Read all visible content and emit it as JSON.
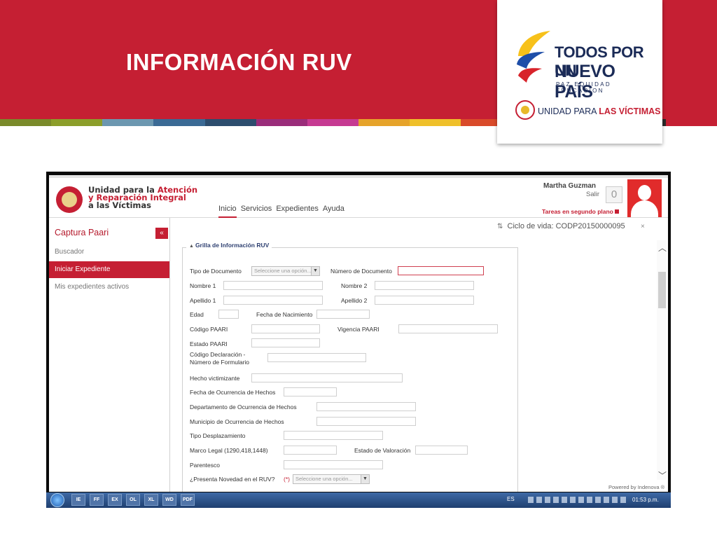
{
  "slide": {
    "title": "INFORMACIÓN RUV",
    "header_color": "#c51f33",
    "strip_colors": [
      "#7a8a2a",
      "#8c9e2a",
      "#6c97b0",
      "#3b6a95",
      "#2d4d6e",
      "#9a2c7a",
      "#c63a92",
      "#e6a32a",
      "#efc02a",
      "#d94a2a",
      "#b03a3a",
      "#5a2a2a",
      "#2a2a2a",
      "#c51f33"
    ]
  },
  "logo_card": {
    "slogan_line1": "TODOS POR UN",
    "slogan_line2": "NUEVO PAÍS",
    "slogan_line3": "PAZ EQUIDAD EDUCACION",
    "unit_prefix": "UNIDAD PARA ",
    "unit_highlight": "LAS VÍCTIMAS"
  },
  "app": {
    "org_line1": "Unidad para la ",
    "org_line1_highlight": "Atención",
    "org_line2": "y Reparación Integral",
    "org_line3": "a las Víctimas",
    "nav": [
      "Inicio",
      "Servicios",
      "Expedientes",
      "Ayuda"
    ],
    "user_name": "Martha Guzman",
    "user_exit": "Salir",
    "counter": "0",
    "tasks_label": "Tareas en segundo plano",
    "sidebar": {
      "title": "Captura Paari",
      "collapse": "«",
      "items": [
        "Buscador",
        "Iniciar Expediente",
        "Mis expedientes activos"
      ]
    },
    "lifecycle": "Ciclo de vida: CODP20150000095",
    "grid_title": "Grilla de Información RUV",
    "form": {
      "tipo_documento": "Tipo de Documento",
      "select_placeholder": "Seleccione una opción...",
      "numero_documento": "Número de Documento",
      "nombre1": "Nombre 1",
      "nombre2": "Nombre 2",
      "apellido1": "Apellido 1",
      "apellido2": "Apellido 2",
      "edad": "Edad",
      "fecha_nacimiento": "Fecha de Nacimiento",
      "codigo_paari": "Código PAARI",
      "vigencia_paari": "Vigencia PAARI",
      "estado_paari": "Estado PAARI",
      "codigo_declaracion_l1": "Código Declaración -",
      "codigo_declaracion_l2": "Número de Formulario",
      "hecho_victimizante": "Hecho victimizante",
      "fecha_ocurrencia": "Fecha de Ocurrencia de Hechos",
      "departamento_ocurrencia": "Departamento de Ocurrencia de Hechos",
      "municipio_ocurrencia": "Municipio de Ocurrencia de Hechos",
      "tipo_desplazamiento": "Tipo Desplazamiento",
      "marco_legal": "Marco Legal (1290,418,1448)",
      "estado_valoracion": "Estado de Valoración",
      "parentesco": "Parentesco",
      "presenta_novedad": "¿Presenta Novedad en el RUV?",
      "required_mark": "(*)",
      "select_placeholder2": "Seleccione una opción..."
    },
    "powered_by": "Powered by Indenova ®"
  },
  "taskbar": {
    "apps": [
      "IE",
      "FF",
      "EX",
      "OL",
      "XL",
      "WD",
      "PDF"
    ],
    "language": "ES",
    "clock": "01:53 p.m."
  },
  "icons": {
    "lifecycle": "flow-icon",
    "collapse": "double-chevron-left-icon",
    "scroll_up": "chevron-up-icon",
    "scroll_down": "chevron-down-icon",
    "dropdown": "dropdown-arrow-icon"
  }
}
